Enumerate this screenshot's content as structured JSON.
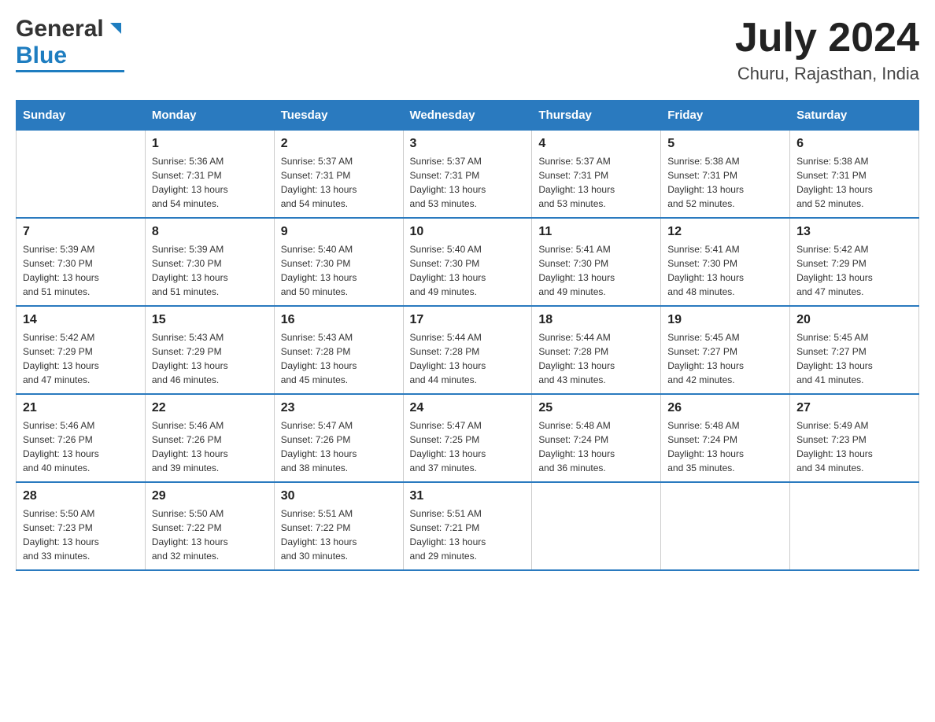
{
  "header": {
    "logo": {
      "general_text": "General",
      "blue_text": "Blue"
    },
    "title": "July 2024",
    "location": "Churu, Rajasthan, India"
  },
  "calendar": {
    "days_of_week": [
      "Sunday",
      "Monday",
      "Tuesday",
      "Wednesday",
      "Thursday",
      "Friday",
      "Saturday"
    ],
    "weeks": [
      [
        {
          "day": "",
          "info": ""
        },
        {
          "day": "1",
          "info": "Sunrise: 5:36 AM\nSunset: 7:31 PM\nDaylight: 13 hours\nand 54 minutes."
        },
        {
          "day": "2",
          "info": "Sunrise: 5:37 AM\nSunset: 7:31 PM\nDaylight: 13 hours\nand 54 minutes."
        },
        {
          "day": "3",
          "info": "Sunrise: 5:37 AM\nSunset: 7:31 PM\nDaylight: 13 hours\nand 53 minutes."
        },
        {
          "day": "4",
          "info": "Sunrise: 5:37 AM\nSunset: 7:31 PM\nDaylight: 13 hours\nand 53 minutes."
        },
        {
          "day": "5",
          "info": "Sunrise: 5:38 AM\nSunset: 7:31 PM\nDaylight: 13 hours\nand 52 minutes."
        },
        {
          "day": "6",
          "info": "Sunrise: 5:38 AM\nSunset: 7:31 PM\nDaylight: 13 hours\nand 52 minutes."
        }
      ],
      [
        {
          "day": "7",
          "info": "Sunrise: 5:39 AM\nSunset: 7:30 PM\nDaylight: 13 hours\nand 51 minutes."
        },
        {
          "day": "8",
          "info": "Sunrise: 5:39 AM\nSunset: 7:30 PM\nDaylight: 13 hours\nand 51 minutes."
        },
        {
          "day": "9",
          "info": "Sunrise: 5:40 AM\nSunset: 7:30 PM\nDaylight: 13 hours\nand 50 minutes."
        },
        {
          "day": "10",
          "info": "Sunrise: 5:40 AM\nSunset: 7:30 PM\nDaylight: 13 hours\nand 49 minutes."
        },
        {
          "day": "11",
          "info": "Sunrise: 5:41 AM\nSunset: 7:30 PM\nDaylight: 13 hours\nand 49 minutes."
        },
        {
          "day": "12",
          "info": "Sunrise: 5:41 AM\nSunset: 7:30 PM\nDaylight: 13 hours\nand 48 minutes."
        },
        {
          "day": "13",
          "info": "Sunrise: 5:42 AM\nSunset: 7:29 PM\nDaylight: 13 hours\nand 47 minutes."
        }
      ],
      [
        {
          "day": "14",
          "info": "Sunrise: 5:42 AM\nSunset: 7:29 PM\nDaylight: 13 hours\nand 47 minutes."
        },
        {
          "day": "15",
          "info": "Sunrise: 5:43 AM\nSunset: 7:29 PM\nDaylight: 13 hours\nand 46 minutes."
        },
        {
          "day": "16",
          "info": "Sunrise: 5:43 AM\nSunset: 7:28 PM\nDaylight: 13 hours\nand 45 minutes."
        },
        {
          "day": "17",
          "info": "Sunrise: 5:44 AM\nSunset: 7:28 PM\nDaylight: 13 hours\nand 44 minutes."
        },
        {
          "day": "18",
          "info": "Sunrise: 5:44 AM\nSunset: 7:28 PM\nDaylight: 13 hours\nand 43 minutes."
        },
        {
          "day": "19",
          "info": "Sunrise: 5:45 AM\nSunset: 7:27 PM\nDaylight: 13 hours\nand 42 minutes."
        },
        {
          "day": "20",
          "info": "Sunrise: 5:45 AM\nSunset: 7:27 PM\nDaylight: 13 hours\nand 41 minutes."
        }
      ],
      [
        {
          "day": "21",
          "info": "Sunrise: 5:46 AM\nSunset: 7:26 PM\nDaylight: 13 hours\nand 40 minutes."
        },
        {
          "day": "22",
          "info": "Sunrise: 5:46 AM\nSunset: 7:26 PM\nDaylight: 13 hours\nand 39 minutes."
        },
        {
          "day": "23",
          "info": "Sunrise: 5:47 AM\nSunset: 7:26 PM\nDaylight: 13 hours\nand 38 minutes."
        },
        {
          "day": "24",
          "info": "Sunrise: 5:47 AM\nSunset: 7:25 PM\nDaylight: 13 hours\nand 37 minutes."
        },
        {
          "day": "25",
          "info": "Sunrise: 5:48 AM\nSunset: 7:24 PM\nDaylight: 13 hours\nand 36 minutes."
        },
        {
          "day": "26",
          "info": "Sunrise: 5:48 AM\nSunset: 7:24 PM\nDaylight: 13 hours\nand 35 minutes."
        },
        {
          "day": "27",
          "info": "Sunrise: 5:49 AM\nSunset: 7:23 PM\nDaylight: 13 hours\nand 34 minutes."
        }
      ],
      [
        {
          "day": "28",
          "info": "Sunrise: 5:50 AM\nSunset: 7:23 PM\nDaylight: 13 hours\nand 33 minutes."
        },
        {
          "day": "29",
          "info": "Sunrise: 5:50 AM\nSunset: 7:22 PM\nDaylight: 13 hours\nand 32 minutes."
        },
        {
          "day": "30",
          "info": "Sunrise: 5:51 AM\nSunset: 7:22 PM\nDaylight: 13 hours\nand 30 minutes."
        },
        {
          "day": "31",
          "info": "Sunrise: 5:51 AM\nSunset: 7:21 PM\nDaylight: 13 hours\nand 29 minutes."
        },
        {
          "day": "",
          "info": ""
        },
        {
          "day": "",
          "info": ""
        },
        {
          "day": "",
          "info": ""
        }
      ]
    ]
  }
}
